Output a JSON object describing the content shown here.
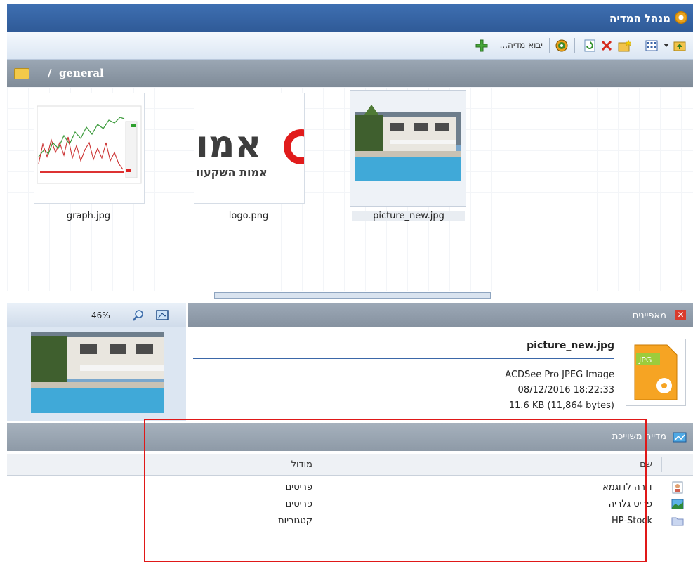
{
  "window": {
    "title": "מנהל המדיה"
  },
  "toolbar": {
    "import_label": "יבוא מדיה..."
  },
  "path": {
    "separator": "/",
    "folder": "general"
  },
  "files": [
    {
      "name": "graph.jpg",
      "selected": false
    },
    {
      "name": "logo.png",
      "selected": false,
      "logo_text_large": "אמו",
      "logo_text_small": "אמות השקעוו"
    },
    {
      "name": "picture_new.jpg",
      "selected": true
    }
  ],
  "preview": {
    "zoom": "46%"
  },
  "properties": {
    "title": "מאפיינים",
    "file_name": "picture_new.jpg",
    "file_type": "ACDSee Pro JPEG Image",
    "date": "08/12/2016 18:22:33",
    "size": "11.6 KB (11,864 bytes)",
    "icon_label": "JPG"
  },
  "associated_media": {
    "title": "מדייה משוייכת",
    "columns": {
      "name": "שם",
      "module": "מודול"
    },
    "rows": [
      {
        "name": "דירה לדוגמא",
        "module": "פריטים",
        "icon": "document-person-icon"
      },
      {
        "name": "פריט גלריה",
        "module": "פריטים",
        "icon": "image-icon"
      },
      {
        "name": "HP-Stock",
        "module": "קטגוריות",
        "icon": "folder-icon"
      }
    ]
  },
  "colors": {
    "title_bar": "#3e6fb1",
    "highlight_box": "#e01818"
  }
}
